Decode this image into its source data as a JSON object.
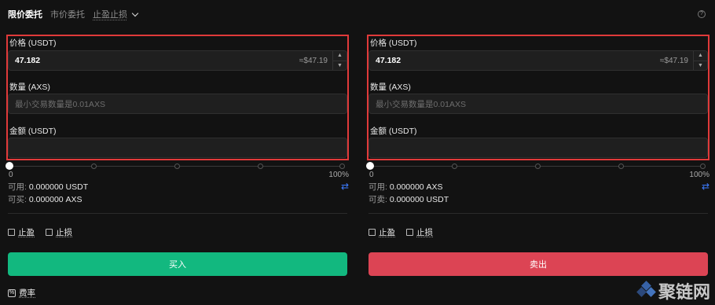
{
  "tabs": [
    {
      "label": "限价委托"
    },
    {
      "label": "市价委托"
    },
    {
      "label": "止盈止损"
    }
  ],
  "buy": {
    "price_label": "价格 (USDT)",
    "price_value": "47.182",
    "price_approx": "≈$47.19",
    "amount_label": "数量 (AXS)",
    "amount_placeholder": "最小交易数量是0.01AXS",
    "total_label": "金额 (USDT)",
    "slider_min": "0",
    "slider_max": "100%",
    "slider_value_pct": 0,
    "avail_label": "可用:",
    "avail_value": "0.000000 USDT",
    "max_label": "可买:",
    "max_value": "0.000000 AXS",
    "take_profit": "止盈",
    "stop_loss": "止损",
    "button": "买入"
  },
  "sell": {
    "price_label": "价格 (USDT)",
    "price_value": "47.182",
    "price_approx": "≈$47.19",
    "amount_label": "数量 (AXS)",
    "amount_placeholder": "最小交易数量是0.01AXS",
    "total_label": "金额 (USDT)",
    "slider_min": "0",
    "slider_max": "100%",
    "slider_value_pct": 0,
    "avail_label": "可用:",
    "avail_value": "0.000000 AXS",
    "max_label": "可卖:",
    "max_value": "0.000000 USDT",
    "take_profit": "止盈",
    "stop_loss": "止损",
    "button": "卖出"
  },
  "fee_label": "费率",
  "watermark": "聚链网",
  "colors": {
    "buy": "#12b87f",
    "sell": "#dc4454",
    "highlight": "#e03a3a",
    "swap": "#3c7bff"
  },
  "icons": [
    "help-icon",
    "swap-icon",
    "fee-icon",
    "chevron-down-icon"
  ]
}
